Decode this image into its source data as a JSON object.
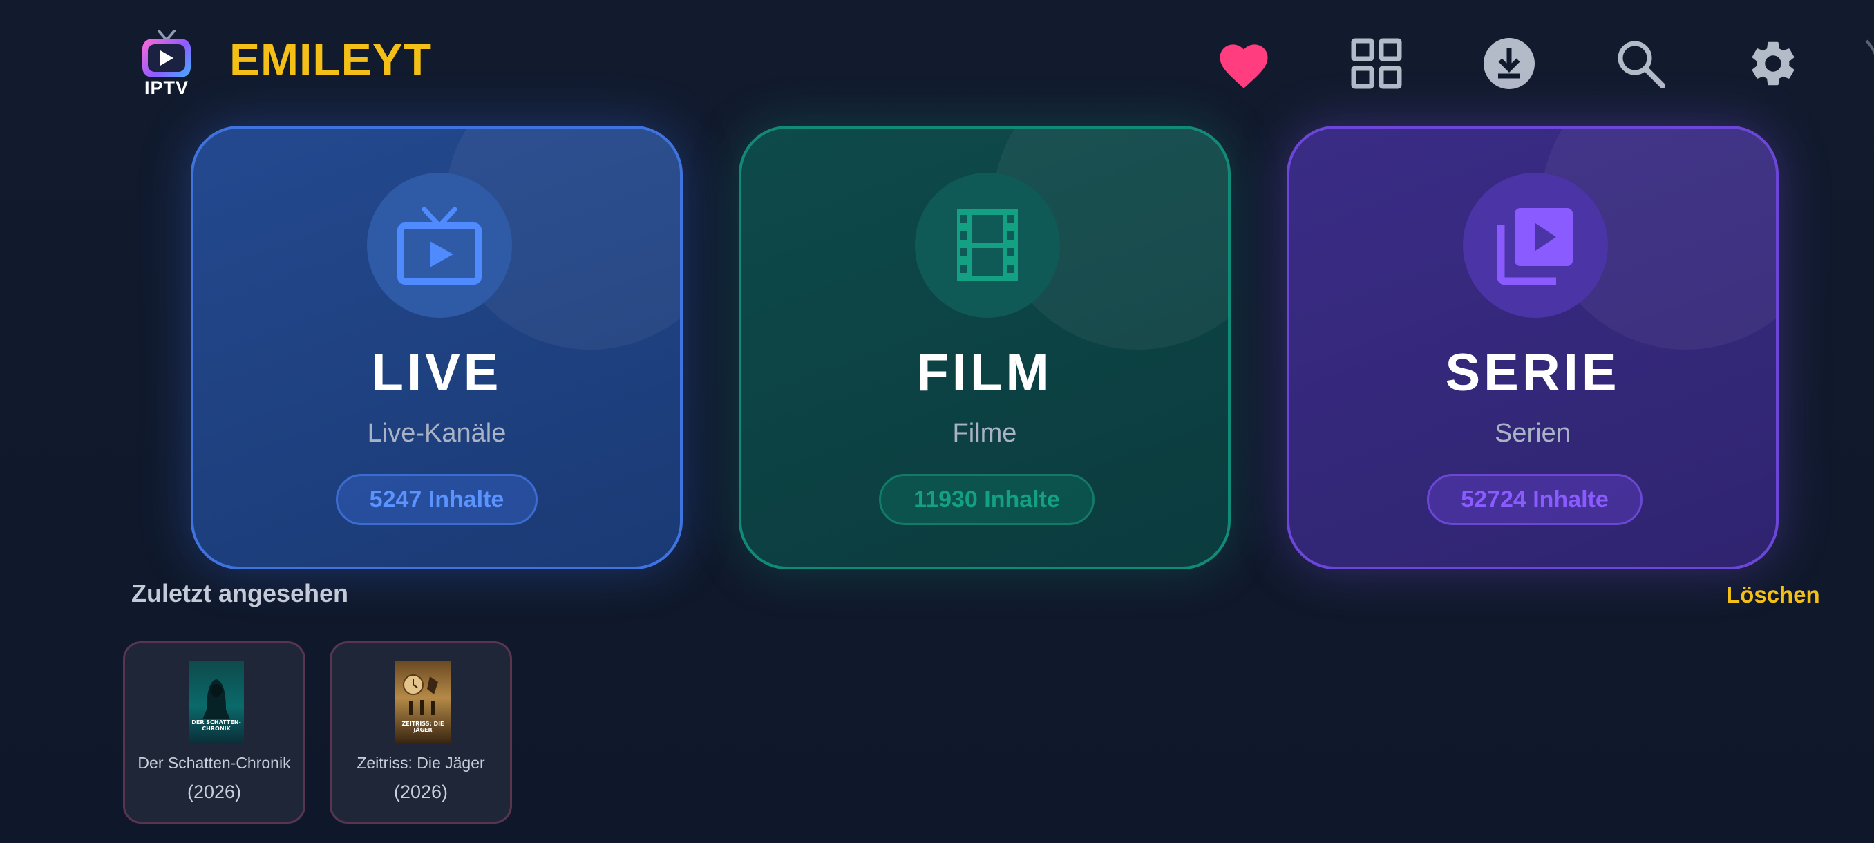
{
  "header": {
    "logo_text": "IPTV",
    "brand": "EMILEYT",
    "icons": [
      "heart-icon",
      "grid-icon",
      "download-icon",
      "search-icon",
      "settings-icon"
    ]
  },
  "cards": [
    {
      "id": "live",
      "title": "LIVE",
      "subtitle": "Live-Kanäle",
      "count": "5247 Inhalte",
      "icon": "tv-play-icon",
      "accent": "#3f73e0"
    },
    {
      "id": "film",
      "title": "FILM",
      "subtitle": "Filme",
      "count": "11930 Inhalte",
      "icon": "film-strip-icon",
      "accent": "#128a78"
    },
    {
      "id": "serie",
      "title": "SERIE",
      "subtitle": "Serien",
      "count": "52724 Inhalte",
      "icon": "video-library-icon",
      "accent": "#6c46d8"
    }
  ],
  "recent": {
    "title": "Zuletzt angesehen",
    "clear_label": "Löschen",
    "items": [
      {
        "name": "Der Schatten-Chronik",
        "year": "(2026)",
        "poster_text": "DER SCHATTEN-CHRONIK"
      },
      {
        "name": "Zeitriss: Die Jäger",
        "year": "(2026)",
        "poster_text": "ZEITRISS: DIE JÄGER"
      }
    ]
  },
  "colors": {
    "brand": "#f4c018",
    "heart": "#ff3d7f",
    "background": "#111a2c"
  }
}
